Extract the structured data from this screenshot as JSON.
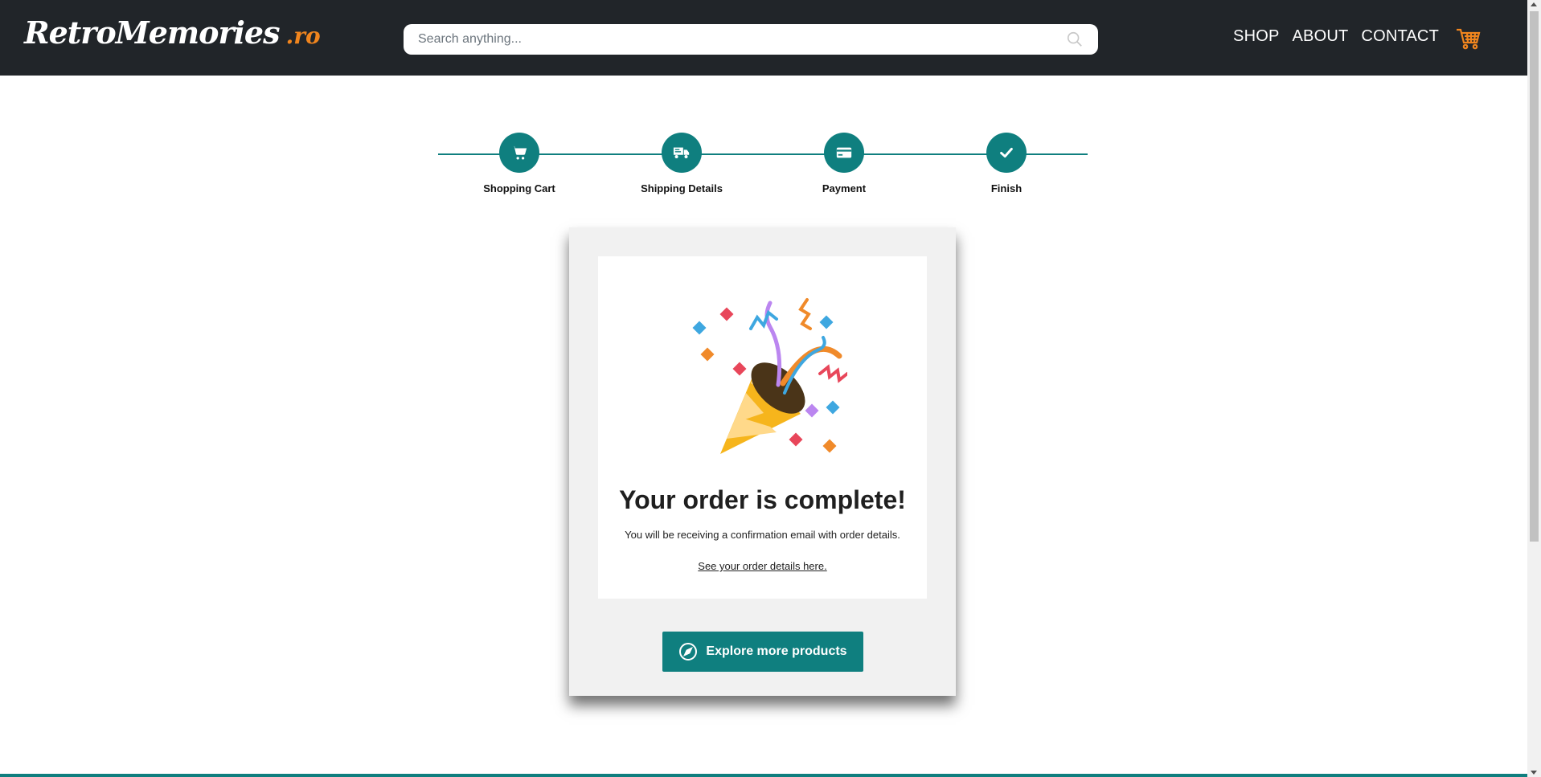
{
  "header": {
    "logo_main": "RetroMemories",
    "logo_suffix": ".ro",
    "search_placeholder": "Search anything...",
    "nav": [
      "SHOP",
      "ABOUT",
      "CONTACT"
    ]
  },
  "stepper": {
    "steps": [
      {
        "label": "Shopping Cart",
        "icon": "cart-icon"
      },
      {
        "label": "Shipping Details",
        "icon": "truck-icon"
      },
      {
        "label": "Payment",
        "icon": "credit-card-icon"
      },
      {
        "label": "Finish",
        "icon": "check-icon"
      }
    ]
  },
  "order": {
    "title": "Your order is complete!",
    "subtitle": "You will be receiving a confirmation email with order details.",
    "details_link": "See your order details here.",
    "explore_button": "Explore more products"
  },
  "colors": {
    "header_bg": "#212529",
    "accent": "#0f7f7f",
    "logo_accent": "#f0851e"
  }
}
